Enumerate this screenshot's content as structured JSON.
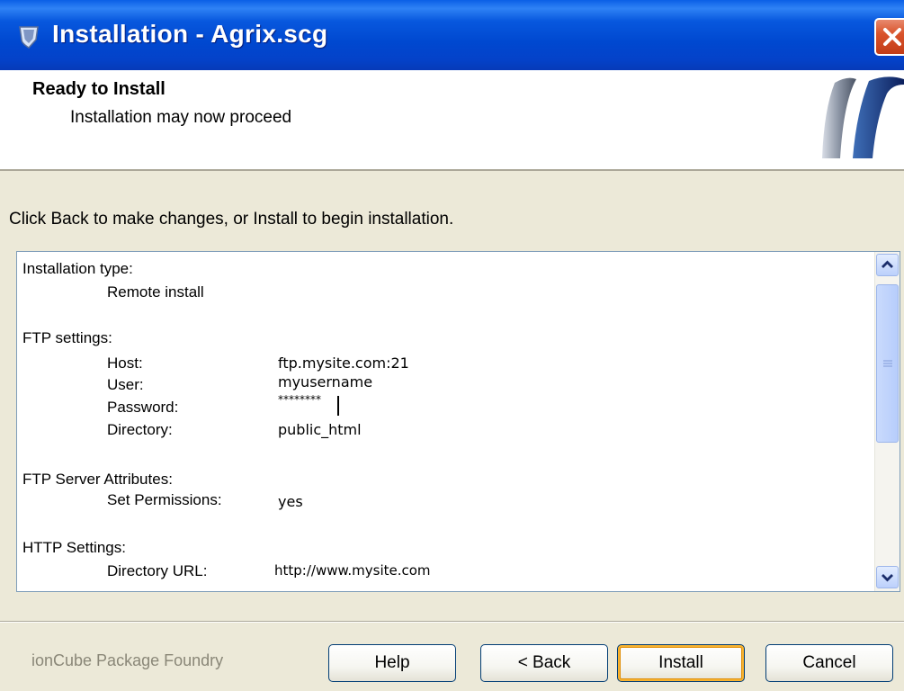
{
  "window": {
    "title": "Installation - Agrix.scg",
    "close_icon": "close-icon"
  },
  "header": {
    "title": "Ready to Install",
    "subtitle": "Installation may now proceed"
  },
  "intro": "Click Back to make changes, or Install to begin installation.",
  "summary": {
    "installation_type_label": "Installation type:",
    "installation_type_value": "Remote install",
    "ftp_label": "FTP settings:",
    "host_label": "Host:",
    "host_value": "ftp.mysite.com:21",
    "user_label": "User:",
    "user_value": "myusername",
    "password_label": "Password:",
    "password_value": "********",
    "directory_label": "Directory:",
    "directory_value": "public_html",
    "server_attr_label": "FTP Server Attributes:",
    "set_permissions_label": "Set Permissions:",
    "set_permissions_value": "yes",
    "http_label": "HTTP Settings:",
    "directory_url_label": "Directory URL:",
    "directory_url_value": "http://www.mysite.com"
  },
  "footer": {
    "brand": "ionCube Package Foundry",
    "help_label": "Help",
    "back_label": "< Back",
    "install_label": "Install",
    "cancel_label": "Cancel"
  },
  "colors": {
    "titlebar": "#0054e3",
    "dialog_bg": "#ece9d8",
    "default_button_ring": "#f8b330"
  }
}
